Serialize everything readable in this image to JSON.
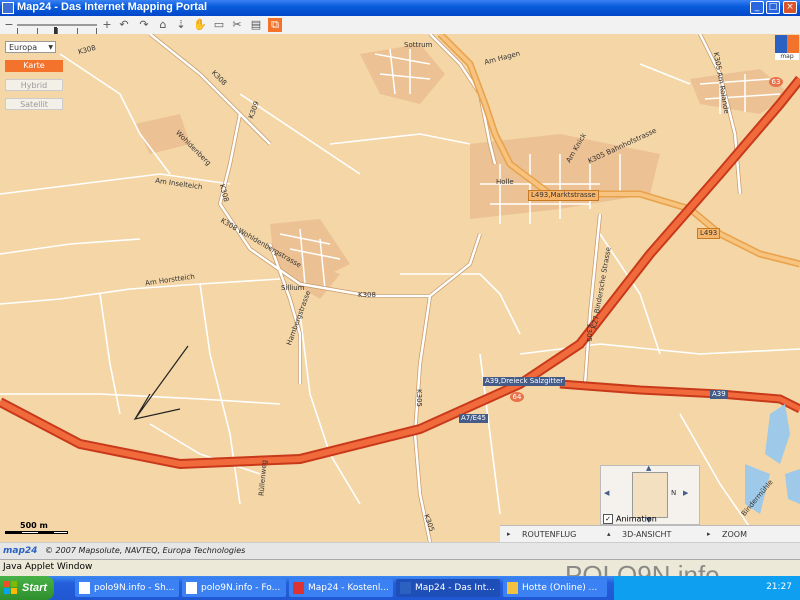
{
  "window": {
    "title": "Map24 - Das Internet Mapping Portal"
  },
  "toolbar": {
    "zoom_out": "−",
    "zoom_in": "+",
    "zoom_level": 0.47
  },
  "maptype": {
    "region": "Europa",
    "buttons": [
      "Karte",
      "Hybrid",
      "Satellit"
    ]
  },
  "logo": {
    "text": "map"
  },
  "map": {
    "labels": [
      {
        "text": "K308"
      },
      {
        "text": "K308"
      },
      {
        "text": "Sottrum"
      },
      {
        "text": "Am Hagen"
      },
      {
        "text": "K309"
      },
      {
        "text": "Wohldenberg"
      },
      {
        "text": "Am Inselteich"
      },
      {
        "text": "K308"
      },
      {
        "text": "K308 Wohldenbergstrasse"
      },
      {
        "text": "Sillium"
      },
      {
        "text": "K308"
      },
      {
        "text": "Am Horstteich"
      },
      {
        "text": "Hambergstrasse"
      },
      {
        "text": "K305"
      },
      {
        "text": "K305"
      },
      {
        "text": "Holle"
      },
      {
        "text": "Am Knick"
      },
      {
        "text": "K305 Bahnhofstrasse"
      },
      {
        "text": "K27 Bindersche Strasse"
      },
      {
        "text": "K305"
      },
      {
        "text": "K305 Am Rolande"
      },
      {
        "text": "Rüllenweg"
      },
      {
        "text": "Bindermühle"
      }
    ],
    "shields": {
      "l493_markt": "L493,Marktstrasse",
      "l493": "L493",
      "a39_dreieck": "A39,Dreieck Salzgitter",
      "a7": "A7/E45",
      "a39": "A39",
      "n63": "63",
      "n64": "64"
    }
  },
  "nav": {
    "east_label": "N"
  },
  "animation": {
    "label": "Animation",
    "checked": "✓"
  },
  "tabs": [
    "ROUTENFLUG",
    "3D-ANSICHT",
    "ZOOM"
  ],
  "scale": {
    "label": "500 m"
  },
  "copyright": {
    "logo": "map24",
    "text": "© 2007 Mapsolute, NAVTEQ, Europa Technologies"
  },
  "status": {
    "text": "Java Applet Window"
  },
  "taskbar": {
    "start": "Start",
    "tasks": [
      "polo9N.info - Sh...",
      "polo9N.info - Fo...",
      "Map24 - Kostenl...",
      "Map24 - Das Int...",
      "Hotte (Online) ..."
    ],
    "time": "21:27"
  },
  "watermark": "POLO9N.info"
}
